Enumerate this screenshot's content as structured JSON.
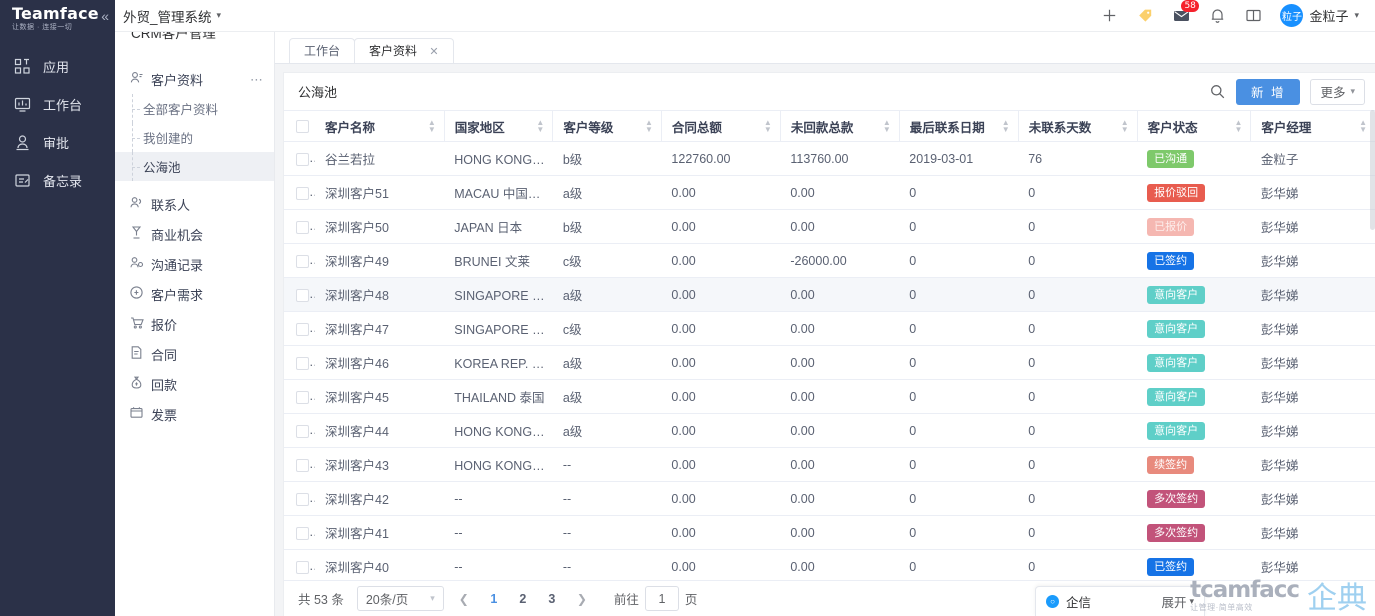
{
  "brand": {
    "name": "Teamface",
    "tagline": "让数据 · 连接一切",
    "collapse_icon": "chevrons-left-icon"
  },
  "rail": {
    "items": [
      {
        "label": "应用",
        "icon": "apps-icon"
      },
      {
        "label": "工作台",
        "icon": "dashboard-icon"
      },
      {
        "label": "审批",
        "icon": "approval-icon"
      },
      {
        "label": "备忘录",
        "icon": "memo-icon"
      }
    ]
  },
  "topbar": {
    "system_name": "外贸_管理系统",
    "add_icon": "plus-icon",
    "tag_icon": "tag-icon",
    "mail_icon": "mail-icon",
    "mail_badge": "58",
    "bell_icon": "bell-icon",
    "book_icon": "book-icon",
    "avatar_text": "粒子",
    "avatar_color": "#1890ff",
    "user_name": "金粒子"
  },
  "subnav": {
    "title": "CRM客户管理",
    "group": {
      "label": "客户资料",
      "icon": "user-card-icon",
      "more_icon": "ellipsis-icon"
    },
    "children": [
      {
        "label": "全部客户资料",
        "active": false
      },
      {
        "label": "我创建的",
        "active": false
      },
      {
        "label": "公海池",
        "active": true
      }
    ],
    "items": [
      {
        "label": "联系人",
        "icon": "contacts-icon"
      },
      {
        "label": "商业机会",
        "icon": "opportunity-icon"
      },
      {
        "label": "沟通记录",
        "icon": "communication-icon"
      },
      {
        "label": "客户需求",
        "icon": "requirement-icon"
      },
      {
        "label": "报价",
        "icon": "quote-icon"
      },
      {
        "label": "合同",
        "icon": "contract-icon"
      },
      {
        "label": "回款",
        "icon": "payment-icon"
      },
      {
        "label": "发票",
        "icon": "invoice-icon"
      }
    ]
  },
  "tabs": [
    {
      "label": "工作台",
      "active": false,
      "closable": false
    },
    {
      "label": "客户资料",
      "active": true,
      "closable": true
    }
  ],
  "card": {
    "view_name": "公海池",
    "search_icon": "search-icon",
    "new_button": "新 增",
    "more_button": "更多",
    "new_button_color": "#4a90e2"
  },
  "table": {
    "columns": [
      {
        "label": "客户名称",
        "sortable": true
      },
      {
        "label": "国家地区",
        "sortable": true
      },
      {
        "label": "客户等级",
        "sortable": true
      },
      {
        "label": "合同总额",
        "sortable": true
      },
      {
        "label": "未回款总款",
        "sortable": true
      },
      {
        "label": "最后联系日期",
        "sortable": true
      },
      {
        "label": "未联系天数",
        "sortable": true
      },
      {
        "label": "客户状态",
        "sortable": true
      },
      {
        "label": "客户经理",
        "sortable": true
      }
    ],
    "rows": [
      {
        "name": "谷兰若拉",
        "country": "HONG KONG 中国...",
        "grade": "b级",
        "contract_total": "122760.00",
        "unpaid_total": "113760.00",
        "last_contact": "2019-03-01",
        "days_no_contact": "76",
        "status": "已沟通",
        "status_color": "#7ec96b",
        "manager": "金粒子",
        "highlight": false,
        "country_caret": false
      },
      {
        "name": "深圳客户51",
        "country": "MACAU 中国澳门",
        "grade": "a级",
        "contract_total": "0.00",
        "unpaid_total": "0.00",
        "last_contact": "0",
        "days_no_contact": "0",
        "status": "报价驳回",
        "status_color": "#e85c4f",
        "manager": "彭华娣",
        "highlight": false,
        "country_caret": false
      },
      {
        "name": "深圳客户50",
        "country": "JAPAN 日本",
        "grade": "b级",
        "contract_total": "0.00",
        "unpaid_total": "0.00",
        "last_contact": "0",
        "days_no_contact": "0",
        "status": "已报价",
        "status_color": "#f5b7b1",
        "manager": "彭华娣",
        "highlight": false,
        "country_caret": false
      },
      {
        "name": "深圳客户49",
        "country": "BRUNEI 文莱",
        "grade": "c级",
        "contract_total": "0.00",
        "unpaid_total": "-26000.00",
        "last_contact": "0",
        "days_no_contact": "0",
        "status": "已签约",
        "status_color": "#1673e6",
        "manager": "彭华娣",
        "highlight": false,
        "country_caret": false
      },
      {
        "name": "深圳客户48",
        "country": "SINGAPORE 新加坡",
        "grade": "a级",
        "contract_total": "0.00",
        "unpaid_total": "0.00",
        "last_contact": "0",
        "days_no_contact": "0",
        "status": "意向客户",
        "status_color": "#5fcfc8",
        "manager": "彭华娣",
        "highlight": true,
        "country_caret": true
      },
      {
        "name": "深圳客户47",
        "country": "SINGAPORE 新加坡",
        "grade": "c级",
        "contract_total": "0.00",
        "unpaid_total": "0.00",
        "last_contact": "0",
        "days_no_contact": "0",
        "status": "意向客户",
        "status_color": "#5fcfc8",
        "manager": "彭华娣",
        "highlight": false,
        "country_caret": false
      },
      {
        "name": "深圳客户46",
        "country": "KOREA REP. 韩国",
        "grade": "a级",
        "contract_total": "0.00",
        "unpaid_total": "0.00",
        "last_contact": "0",
        "days_no_contact": "0",
        "status": "意向客户",
        "status_color": "#5fcfc8",
        "manager": "彭华娣",
        "highlight": false,
        "country_caret": false
      },
      {
        "name": "深圳客户45",
        "country": "THAILAND 泰国",
        "grade": "a级",
        "contract_total": "0.00",
        "unpaid_total": "0.00",
        "last_contact": "0",
        "days_no_contact": "0",
        "status": "意向客户",
        "status_color": "#5fcfc8",
        "manager": "彭华娣",
        "highlight": false,
        "country_caret": false
      },
      {
        "name": "深圳客户44",
        "country": "HONG KONG 中国...",
        "grade": "a级",
        "contract_total": "0.00",
        "unpaid_total": "0.00",
        "last_contact": "0",
        "days_no_contact": "0",
        "status": "意向客户",
        "status_color": "#5fcfc8",
        "manager": "彭华娣",
        "highlight": false,
        "country_caret": false
      },
      {
        "name": "深圳客户43",
        "country": "HONG KONG 中国...",
        "grade": "--",
        "contract_total": "0.00",
        "unpaid_total": "0.00",
        "last_contact": "0",
        "days_no_contact": "0",
        "status": "续签约",
        "status_color": "#e88a7d",
        "manager": "彭华娣",
        "highlight": false,
        "country_caret": false
      },
      {
        "name": "深圳客户42",
        "country": "--",
        "grade": "--",
        "contract_total": "0.00",
        "unpaid_total": "0.00",
        "last_contact": "0",
        "days_no_contact": "0",
        "status": "多次签约",
        "status_color": "#c2537a",
        "manager": "彭华娣",
        "highlight": false,
        "country_caret": false
      },
      {
        "name": "深圳客户41",
        "country": "--",
        "grade": "--",
        "contract_total": "0.00",
        "unpaid_total": "0.00",
        "last_contact": "0",
        "days_no_contact": "0",
        "status": "多次签约",
        "status_color": "#c2537a",
        "manager": "彭华娣",
        "highlight": false,
        "country_caret": false
      },
      {
        "name": "深圳客户40",
        "country": "--",
        "grade": "--",
        "contract_total": "0.00",
        "unpaid_total": "0.00",
        "last_contact": "0",
        "days_no_contact": "0",
        "status": "已签约",
        "status_color": "#1673e6",
        "manager": "彭华娣",
        "highlight": false,
        "country_caret": false
      }
    ]
  },
  "pagination": {
    "total_text": "共 53 条",
    "page_size": "20条/页",
    "prev_icon": "chevron-left-icon",
    "next_icon": "chevron-right-icon",
    "pages": [
      "1",
      "2",
      "3"
    ],
    "current_page": "1",
    "jump_prefix": "前往",
    "jump_value": "1",
    "jump_suffix": "页"
  },
  "chat": {
    "icon": "chat-search-icon",
    "label": "企信",
    "expand_label": "展开"
  },
  "watermark": {
    "brand": "tcamfacc",
    "tagline": "让管理·简单高效",
    "cn": "企典"
  }
}
